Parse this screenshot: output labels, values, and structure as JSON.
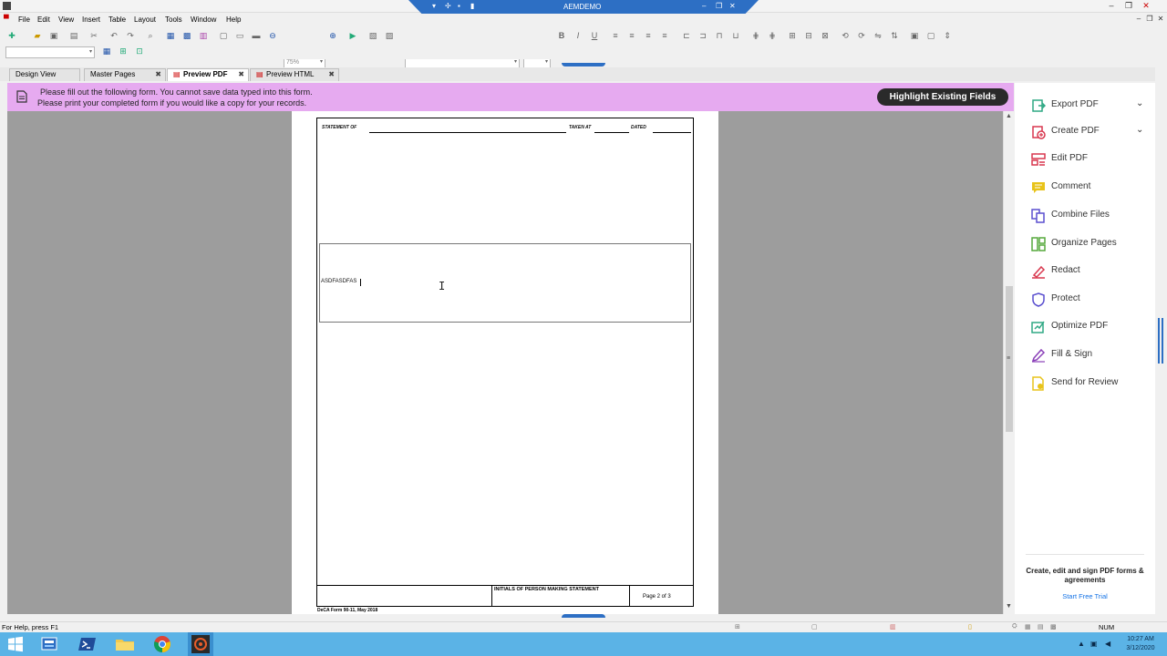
{
  "window": {
    "remote_title": "AEMDEMO",
    "controls": [
      "minimize-icon",
      "restore-icon",
      "close-icon"
    ]
  },
  "menu": {
    "items": [
      "File",
      "Edit",
      "View",
      "Insert",
      "Table",
      "Layout",
      "Tools",
      "Window",
      "Help"
    ]
  },
  "toolbar": {
    "zoom": "75%"
  },
  "tabs": [
    {
      "label": "Design View",
      "active": false
    },
    {
      "label": "Master Pages",
      "active": false
    },
    {
      "label": "Preview PDF",
      "active": true
    },
    {
      "label": "Preview HTML",
      "active": false
    }
  ],
  "notice": {
    "line1": "Please fill out the following form. You cannot save data typed into this form.",
    "line2": "Please print your completed form if you would like a copy for your records.",
    "highlight_button": "Highlight Existing Fields",
    "bg_color": "#e6aaf0"
  },
  "form": {
    "statement_of": "STATEMENT OF",
    "taken_at": "TAKEN AT",
    "dated": "DATED",
    "field_value": "ASDFASDFAS",
    "initials_label": "INITIALS OF PERSON MAKING STATEMENT",
    "page_label": "Page 2 of 3",
    "form_id": "DeCA Form 90-11, May 2018"
  },
  "tools_panel": {
    "items": [
      {
        "label": "Export PDF",
        "icon": "export-pdf-icon",
        "color": "#2fa884",
        "expandable": true
      },
      {
        "label": "Create PDF",
        "icon": "create-pdf-icon",
        "color": "#d8374e",
        "expandable": true
      },
      {
        "label": "Edit PDF",
        "icon": "edit-pdf-icon",
        "color": "#d8374e",
        "expandable": false
      },
      {
        "label": "Comment",
        "icon": "comment-icon",
        "color": "#e8c31a",
        "expandable": false
      },
      {
        "label": "Combine Files",
        "icon": "combine-files-icon",
        "color": "#5a4fcf",
        "expandable": false
      },
      {
        "label": "Organize Pages",
        "icon": "organize-pages-icon",
        "color": "#55a83b",
        "expandable": false
      },
      {
        "label": "Redact",
        "icon": "redact-icon",
        "color": "#d8374e",
        "expandable": false
      },
      {
        "label": "Protect",
        "icon": "protect-icon",
        "color": "#5a4fcf",
        "expandable": false
      },
      {
        "label": "Optimize PDF",
        "icon": "optimize-pdf-icon",
        "color": "#2fa884",
        "expandable": false
      },
      {
        "label": "Fill & Sign",
        "icon": "fill-sign-icon",
        "color": "#8a3fb8",
        "expandable": false
      },
      {
        "label": "Send for Review",
        "icon": "send-review-icon",
        "color": "#e8c31a",
        "expandable": false
      }
    ],
    "promo": "Create, edit and sign PDF forms & agreements",
    "trial_link": "Start Free Trial"
  },
  "status": {
    "help": "For Help, press F1",
    "num": "NUM"
  },
  "taskbar": {
    "time": "10:27 AM",
    "date": "3/12/2020"
  }
}
